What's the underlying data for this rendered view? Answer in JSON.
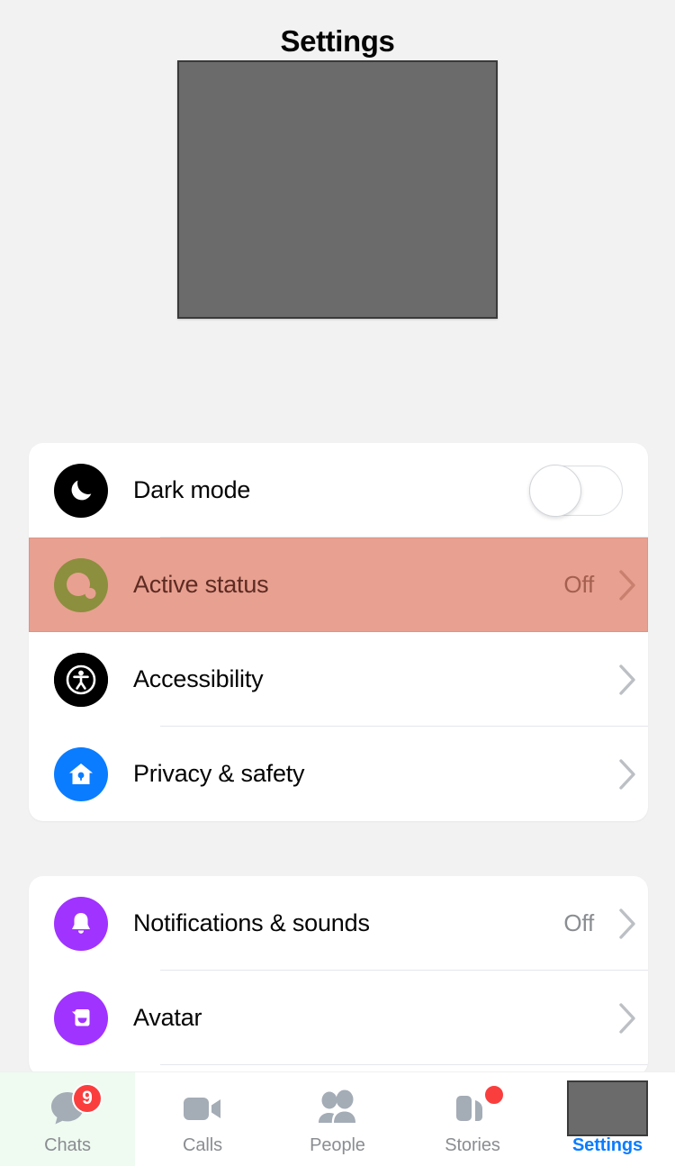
{
  "header": {
    "title": "Settings"
  },
  "profile": {
    "image_placeholder": "profile-image-placeholder",
    "placeholder_color": "#6b6b6b"
  },
  "theme": {
    "background": "#f2f2f2",
    "card_background": "#ffffff",
    "highlight_color": "#e8a091",
    "accent_blue": "#0a7cff",
    "badge_red": "#fa3e3e",
    "secondary_text": "#8a8d91"
  },
  "sections": [
    {
      "id": "preferences",
      "rows": [
        {
          "label": "Dark mode",
          "icon": "moon-icon",
          "icon_bg": "#000000",
          "control": "toggle",
          "toggle_on": false,
          "value": "",
          "highlighted": false
        },
        {
          "label": "Active status",
          "icon": "active-status-icon",
          "icon_bg": "#31a24c",
          "control": "chevron",
          "value": "Off",
          "highlighted": true
        },
        {
          "label": "Accessibility",
          "icon": "accessibility-icon",
          "icon_bg": "#000000",
          "control": "chevron",
          "value": "",
          "highlighted": false
        },
        {
          "label": "Privacy & safety",
          "icon": "privacy-house-lock-icon",
          "icon_bg": "#0a7cff",
          "control": "chevron",
          "value": "",
          "highlighted": false
        }
      ]
    },
    {
      "id": "account",
      "rows": [
        {
          "label": "Notifications & sounds",
          "icon": "bell-icon",
          "icon_bg": "#a033ff",
          "control": "chevron",
          "value": "Off",
          "highlighted": false
        },
        {
          "label": "Avatar",
          "icon": "avatar-face-icon",
          "icon_bg": "#a033ff",
          "control": "chevron",
          "value": "",
          "highlighted": false
        }
      ]
    }
  ],
  "bottom_nav": {
    "tabs": [
      {
        "label": "Chats",
        "icon": "chat-bubble-icon",
        "badge": "9",
        "badge_type": "count",
        "active": false,
        "tinted": true
      },
      {
        "label": "Calls",
        "icon": "video-camera-icon",
        "badge": "",
        "badge_type": "none",
        "active": false,
        "tinted": false
      },
      {
        "label": "People",
        "icon": "people-icon",
        "badge": "",
        "badge_type": "none",
        "active": false,
        "tinted": false
      },
      {
        "label": "Stories",
        "icon": "stories-icon",
        "badge": "",
        "badge_type": "dot",
        "active": false,
        "tinted": false
      },
      {
        "label": "Settings",
        "icon": "profile-thumbnail-placeholder",
        "badge": "",
        "badge_type": "none",
        "active": true,
        "tinted": false
      }
    ]
  }
}
